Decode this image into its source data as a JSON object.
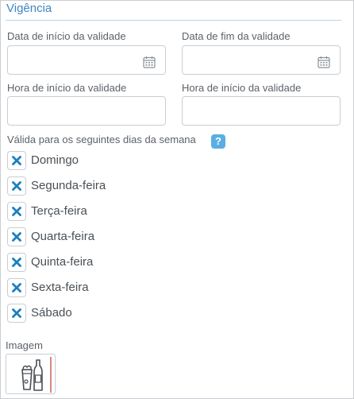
{
  "section": {
    "title": "Vigência"
  },
  "fields": {
    "start_date": {
      "label": "Data de início da validade",
      "value": "",
      "icon": "calendar-icon"
    },
    "end_date": {
      "label": "Data de fim da validade",
      "value": "",
      "icon": "calendar-icon"
    },
    "start_time": {
      "label": "Hora de início da validade",
      "value": ""
    },
    "end_time": {
      "label": "Hora de início da validade",
      "value": ""
    }
  },
  "days": {
    "label": "Válida para os seguintes dias da semana",
    "help_icon": "?",
    "items": [
      {
        "label": "Domingo",
        "checked": true
      },
      {
        "label": "Segunda-feira",
        "checked": true
      },
      {
        "label": "Terça-feira",
        "checked": true
      },
      {
        "label": "Quarta-feira",
        "checked": true
      },
      {
        "label": "Quinta-feira",
        "checked": true
      },
      {
        "label": "Sexta-feira",
        "checked": true
      },
      {
        "label": "Sábado",
        "checked": true
      }
    ]
  },
  "image": {
    "label": "Imagem",
    "icon": "beer-bottle-glass-icon"
  },
  "colors": {
    "accent": "#3f86c0",
    "check": "#1d7fbf",
    "help": "#5aaee4",
    "border": "#c9ced3"
  }
}
